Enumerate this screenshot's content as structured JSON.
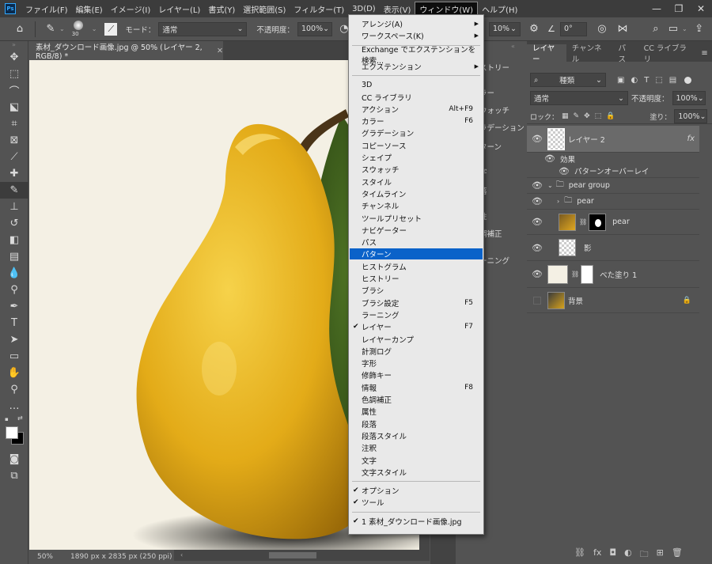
{
  "menubar": {
    "items": [
      "ファイル(F)",
      "編集(E)",
      "イメージ(I)",
      "レイヤー(L)",
      "書式(Y)",
      "選択範囲(S)",
      "フィルター(T)",
      "3D(D)",
      "表示(V)",
      "ウィンドウ(W)",
      "ヘルプ(H)"
    ]
  },
  "options": {
    "brush_size": "30",
    "mode_label": "モード：",
    "mode_value": "通常",
    "opacity_label": "不透明度：",
    "opacity_value": "100%",
    "flow_value": "10%",
    "angle_value": "0°"
  },
  "document": {
    "tab_title": "素材_ダウンロード画像.jpg @ 50% (レイヤー 2, RGB/8) *",
    "zoom": "50%",
    "dimensions": "1890 px x 2835 px (250 ppi)"
  },
  "midpanel": {
    "items": [
      "ストリー",
      "ラー",
      "ウォッチ",
      "ラデーション",
      "ターン",
      "字",
      "落",
      "性",
      "調補正",
      "ーニング"
    ]
  },
  "layers_panel": {
    "tabs": [
      "レイヤー",
      "チャンネル",
      "パス",
      "CC ライブラリ"
    ],
    "filter_value": "種類",
    "blend_mode": "通常",
    "opacity_label": "不透明度：",
    "opacity_value": "100%",
    "lock_label": "ロック：",
    "fill_label": "塗り：",
    "fill_value": "100%",
    "layers": [
      {
        "name": "レイヤー 2",
        "fx": "fx"
      },
      {
        "name": "効果"
      },
      {
        "name": "パターンオーバーレイ"
      },
      {
        "name": "pear group"
      },
      {
        "name": "pear"
      },
      {
        "name": "pear"
      },
      {
        "name": "影"
      },
      {
        "name": "べた塗り 1"
      },
      {
        "name": "背景"
      }
    ]
  },
  "window_menu": {
    "items": [
      {
        "label": "アレンジ(A)",
        "submenu": true
      },
      {
        "label": "ワークスペース(K)",
        "submenu": true
      },
      {
        "label": "Exchange でエクステンションを検索..."
      },
      {
        "label": "エクステンション",
        "submenu": true
      },
      {
        "label": "3D"
      },
      {
        "label": "CC ライブラリ"
      },
      {
        "label": "アクション",
        "shortcut": "Alt+F9"
      },
      {
        "label": "カラー",
        "shortcut": "F6"
      },
      {
        "label": "グラデーション"
      },
      {
        "label": "コピーソース"
      },
      {
        "label": "シェイプ"
      },
      {
        "label": "スウォッチ"
      },
      {
        "label": "スタイル"
      },
      {
        "label": "タイムライン"
      },
      {
        "label": "チャンネル"
      },
      {
        "label": "ツールプリセット"
      },
      {
        "label": "ナビゲーター"
      },
      {
        "label": "パス"
      },
      {
        "label": "パターン",
        "highlighted": true
      },
      {
        "label": "ヒストグラム"
      },
      {
        "label": "ヒストリー"
      },
      {
        "label": "ブラシ"
      },
      {
        "label": "ブラシ設定",
        "shortcut": "F5"
      },
      {
        "label": "ラーニング"
      },
      {
        "label": "レイヤー",
        "checked": true,
        "shortcut": "F7"
      },
      {
        "label": "レイヤーカンプ"
      },
      {
        "label": "計測ログ"
      },
      {
        "label": "字形"
      },
      {
        "label": "修飾キー"
      },
      {
        "label": "情報",
        "shortcut": "F8"
      },
      {
        "label": "色調補正"
      },
      {
        "label": "属性"
      },
      {
        "label": "段落"
      },
      {
        "label": "段落スタイル"
      },
      {
        "label": "注釈"
      },
      {
        "label": "文字"
      },
      {
        "label": "文字スタイル"
      },
      {
        "label": "オプション",
        "checked": true
      },
      {
        "label": "ツール",
        "checked": true
      },
      {
        "label": "1 素材_ダウンロード画像.jpg",
        "checked": true
      }
    ],
    "check_glyph": "✔",
    "arrow_glyph": "▶"
  },
  "colors": {
    "accent_highlight": "#0a62c9",
    "menu_bg": "#e9e9e9",
    "pear_yellow": "#e8b51c",
    "leaf_green": "#3b5a1b"
  }
}
